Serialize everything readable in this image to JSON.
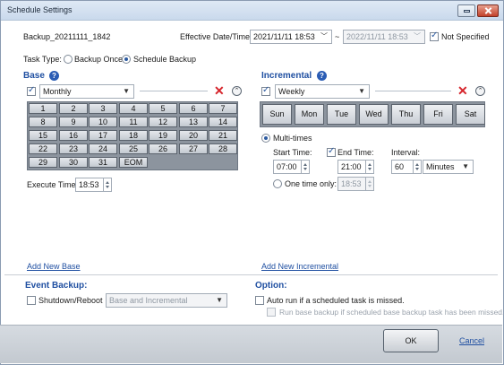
{
  "window": {
    "title": "Schedule Settings"
  },
  "schedule_name": "Backup_20211111_1842",
  "effective": {
    "label": "Effective Date/Time:",
    "start": "2021/11/11 18:53",
    "separator": "~",
    "end": "2022/11/11 18:53",
    "not_specified_label": "Not Specified",
    "not_specified_checked": true
  },
  "task_type": {
    "label": "Task Type:",
    "options": [
      "Backup Once",
      "Schedule Backup"
    ],
    "selected": "Schedule Backup"
  },
  "base": {
    "title": "Base",
    "frequency": "Monthly",
    "enabled": true,
    "days": [
      [
        "1",
        "2",
        "3",
        "4",
        "5",
        "6",
        "7"
      ],
      [
        "8",
        "9",
        "10",
        "11",
        "12",
        "13",
        "14"
      ],
      [
        "15",
        "16",
        "17",
        "18",
        "19",
        "20",
        "21"
      ],
      [
        "22",
        "23",
        "24",
        "25",
        "26",
        "27",
        "28"
      ],
      [
        "29",
        "30",
        "31",
        "EOM"
      ]
    ],
    "execute_time_label": "Execute Time:",
    "execute_time": "18:53",
    "add_link": "Add New Base"
  },
  "incremental": {
    "title": "Incremental",
    "frequency": "Weekly",
    "enabled": true,
    "weekdays": [
      "Sun",
      "Mon",
      "Tue",
      "Wed",
      "Thu",
      "Fri",
      "Sat"
    ],
    "multi_times_label": "Multi-times",
    "start_time_label": "Start Time:",
    "end_time_label": "End Time:",
    "interval_label": "Interval:",
    "start_time": "07:00",
    "end_time": "21:00",
    "end_time_checked": true,
    "interval_value": "60",
    "interval_unit": "Minutes",
    "one_time_label": "One time only:",
    "one_time_value": "18:53",
    "add_link": "Add New Incremental"
  },
  "event_backup": {
    "title": "Event Backup:",
    "shutdown_label": "Shutdown/Reboot",
    "shutdown_checked": false,
    "mode": "Base and Incremental"
  },
  "option": {
    "title": "Option:",
    "auto_run_label": "Auto run if a scheduled task is missed.",
    "auto_run_checked": false,
    "run_base_label": "Run base backup if scheduled base backup task has been missed.",
    "run_base_checked": false
  },
  "footer": {
    "ok": "OK",
    "cancel": "Cancel"
  }
}
